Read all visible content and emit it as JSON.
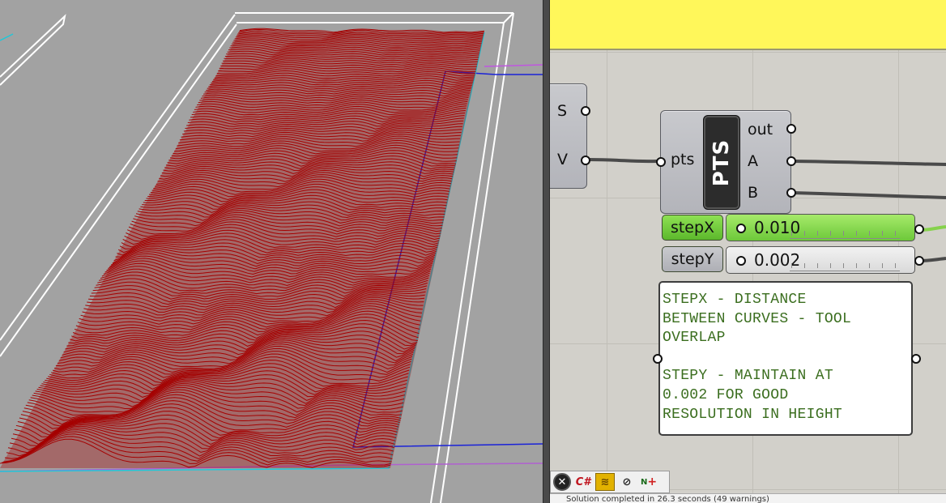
{
  "components": {
    "partial": {
      "inputs": [
        "S",
        "V"
      ]
    },
    "pts": {
      "title": "PTS",
      "input": "pts",
      "outputs": [
        "out",
        "A",
        "B"
      ]
    }
  },
  "sliders": [
    {
      "label": "stepX",
      "value": "0.010",
      "active": true
    },
    {
      "label": "stepY",
      "value": "0.002",
      "active": false
    }
  ],
  "note": {
    "text": "STEPX - DISTANCE\nBETWEEN CURVES - TOOL\nOVERLAP\n\nSTEPY - MAINTAIN AT\n0.002 FOR GOOD\nRESOLUTION IN HEIGHT"
  },
  "toolbar": {
    "buttons": [
      {
        "name": "close-icon",
        "glyph": "✕"
      },
      {
        "name": "csharp-icon",
        "glyph": "C#"
      },
      {
        "name": "preview-icon",
        "glyph": "≋"
      },
      {
        "name": "link-icon",
        "glyph": "⊘"
      },
      {
        "name": "number-icon",
        "glyph": "N"
      }
    ]
  },
  "status": {
    "text": "Solution completed in 26.3 seconds (49 warnings)"
  },
  "colors": {
    "mesh": "#a50000",
    "group": "#fff75a",
    "slider_active": "#74cf3c",
    "note_text": "#3b6e1f"
  }
}
